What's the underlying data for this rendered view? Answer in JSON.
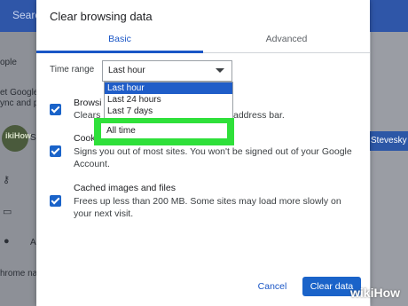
{
  "background": {
    "search_partial": "Search",
    "left_texts": [
      "ople",
      "et Google",
      "ync and p",
      "hrome na"
    ],
    "avatar_text": "ikiHow",
    "right_button": "Stevesky",
    "left_partial_labels": [
      "S",
      "A"
    ]
  },
  "dialog": {
    "title": "Clear browsing data",
    "tabs": [
      {
        "label": "Basic"
      },
      {
        "label": "Advanced"
      }
    ],
    "time_range": {
      "label": "Time range",
      "selected": "Last hour",
      "options": [
        "Last hour",
        "Last 24 hours",
        "Last 7 days",
        "All time"
      ]
    },
    "items": [
      {
        "title": "Browsi",
        "desc_start": "Clears",
        "desc_end": "address bar."
      },
      {
        "title": "Cooki",
        "desc": "Signs you out of most sites. You won't be signed out of your Google Account."
      },
      {
        "title": "Cached images and files",
        "desc": "Frees up less than 200 MB. Some sites may load more slowly on your next visit."
      }
    ],
    "cancel_label": "Cancel",
    "clear_label": "Clear data"
  },
  "watermark": "wikiHow",
  "colors": {
    "accent": "#1a63c9",
    "highlight": "#2fe03a",
    "selected_option": "#1f5dc8"
  }
}
